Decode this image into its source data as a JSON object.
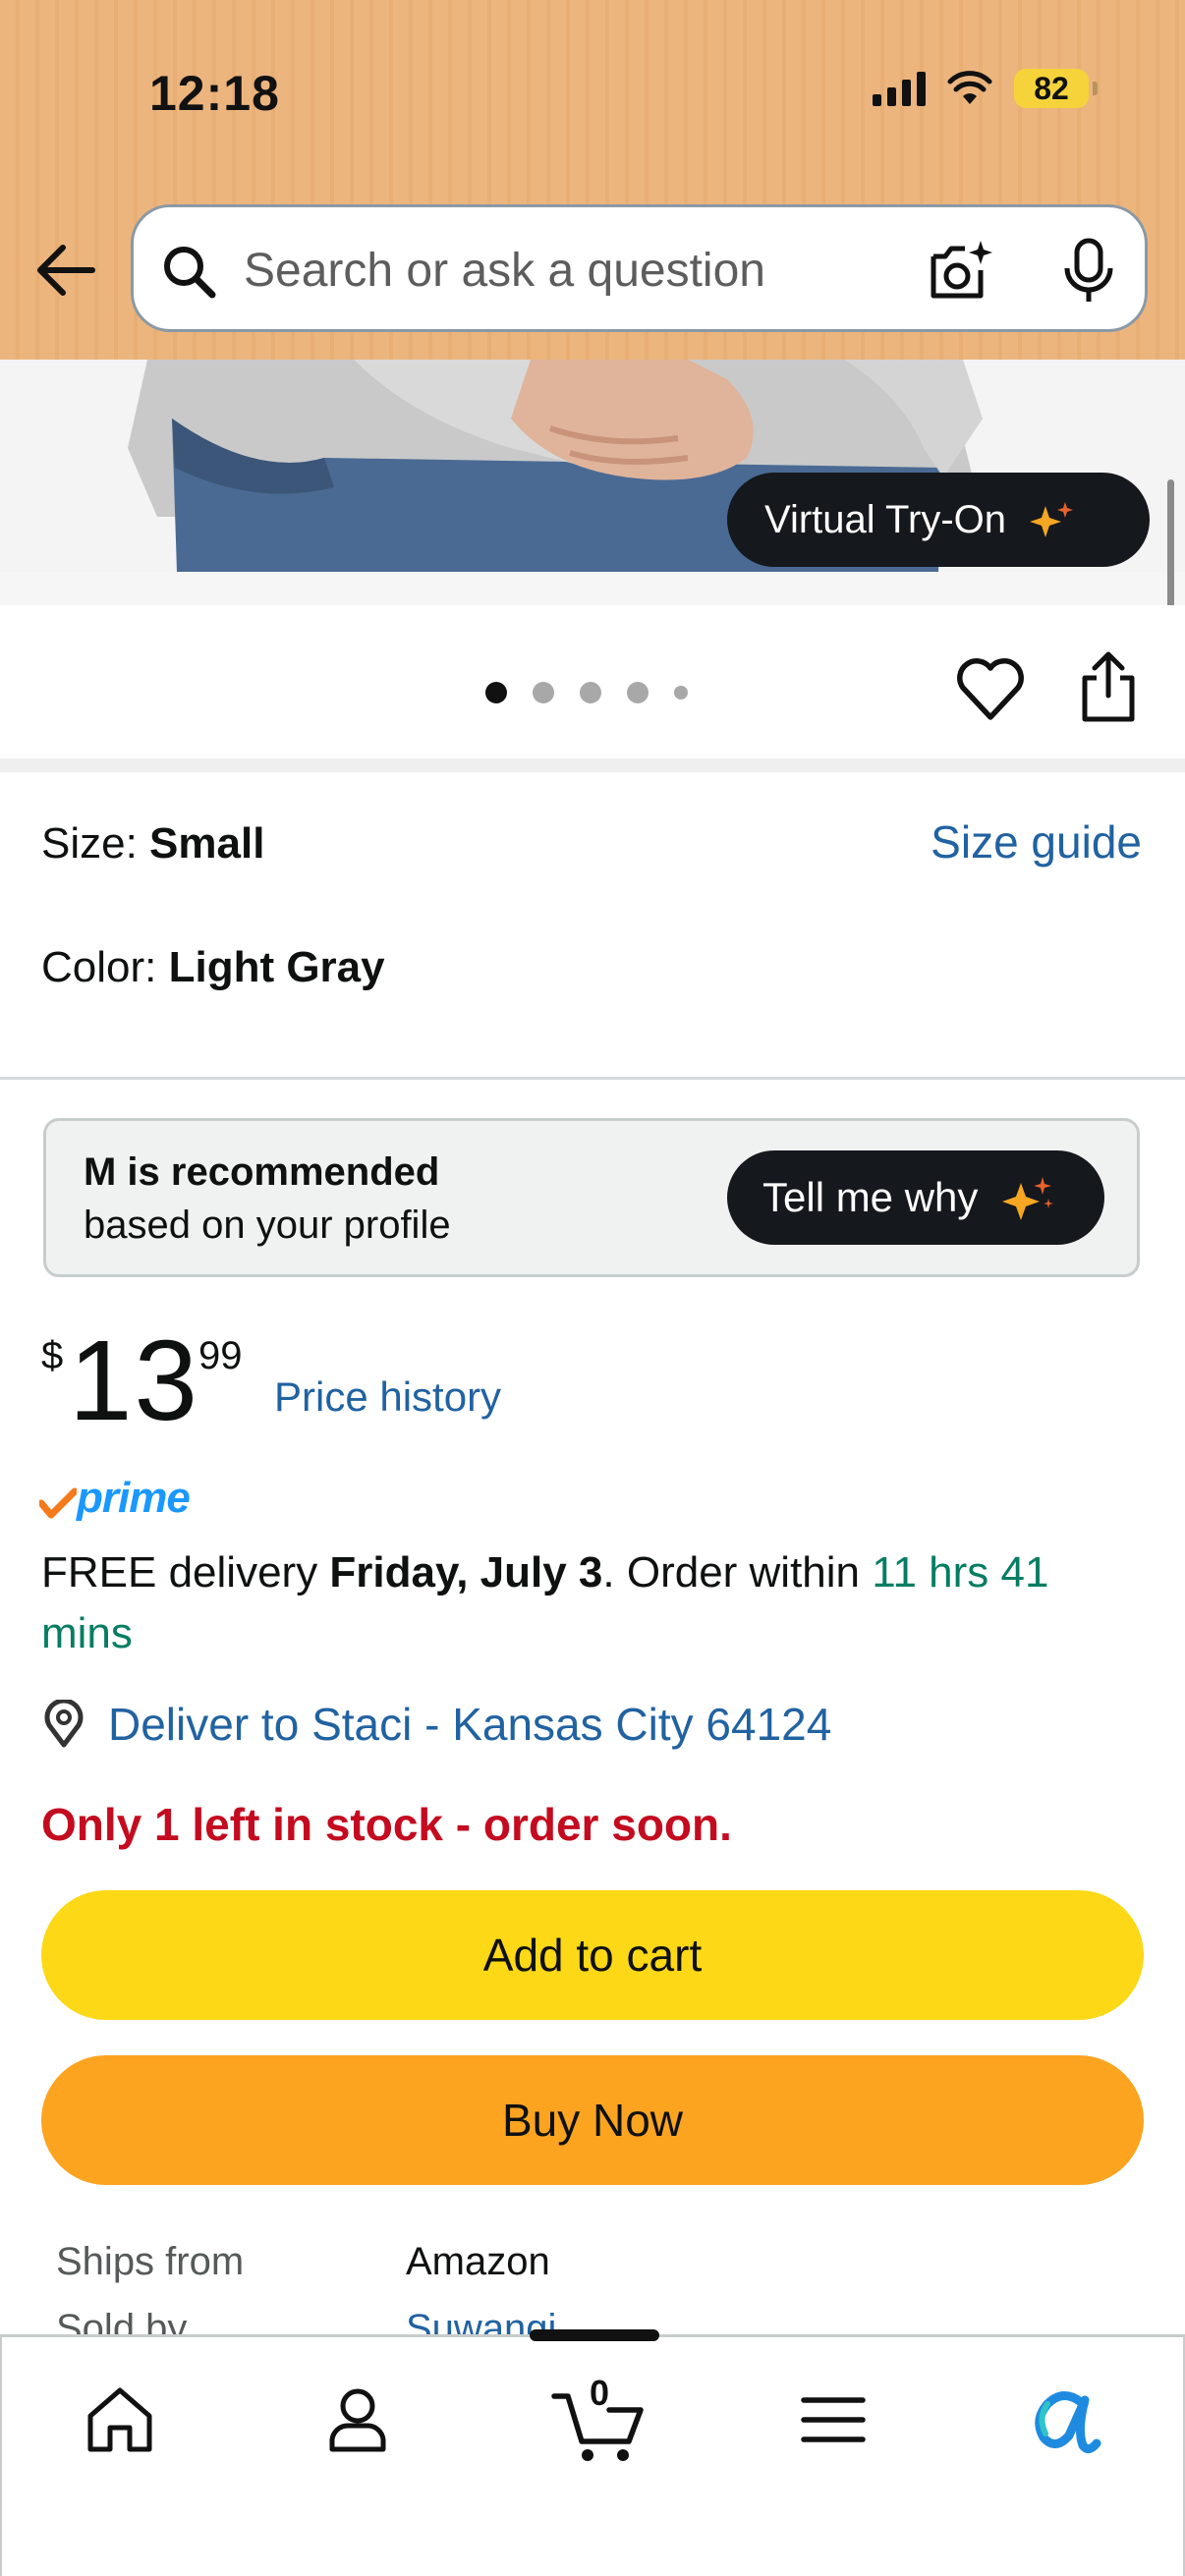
{
  "status_bar": {
    "time": "12:18",
    "battery": "82"
  },
  "header": {
    "search_placeholder": "Search or ask a question",
    "back_icon": "back-arrow-icon",
    "camera_icon": "camera-search-icon",
    "mic_icon": "microphone-icon"
  },
  "gallery": {
    "virtual_try_on_label": "Virtual Try-On",
    "image_count": 5,
    "active_image": 1
  },
  "variations": {
    "size_prefix": "Size: ",
    "size_value": "Small",
    "size_guide_label": "Size guide",
    "color_prefix": "Color: ",
    "color_value": "Light Gray"
  },
  "recommendation": {
    "title": "M is recommended",
    "subtitle": "based on your profile",
    "button_label": "Tell me why"
  },
  "price": {
    "symbol": "$",
    "whole": "13",
    "fraction": "99",
    "history_label": "Price history"
  },
  "prime_label": "prime",
  "delivery": {
    "prefix": "FREE delivery ",
    "date": "Friday, July 3",
    "middle": ". Order within ",
    "countdown": "11 hrs 41 mins"
  },
  "deliver_to": "Deliver to Staci - Kansas City 64124",
  "stock_message": "Only 1 left in stock - order soon.",
  "buttons": {
    "add_to_cart": "Add to cart",
    "buy_now": "Buy Now"
  },
  "info": {
    "ships_from_label": "Ships from",
    "ships_from_value": "Amazon",
    "sold_by_label": "Sold by",
    "sold_by_value": "Suwangi"
  },
  "bottom_nav": {
    "cart_count": "0",
    "items": [
      "home-icon",
      "account-icon",
      "cart-icon",
      "menu-icon",
      "rufus-icon"
    ]
  },
  "colors": {
    "header_bg": "#ecb57e",
    "link": "#2162a1",
    "add_to_cart": "#fcd816",
    "buy_now": "#fca420",
    "stock_red": "#c40b1f",
    "delivery_green": "#067d62",
    "prime_blue": "#1a98ff"
  }
}
